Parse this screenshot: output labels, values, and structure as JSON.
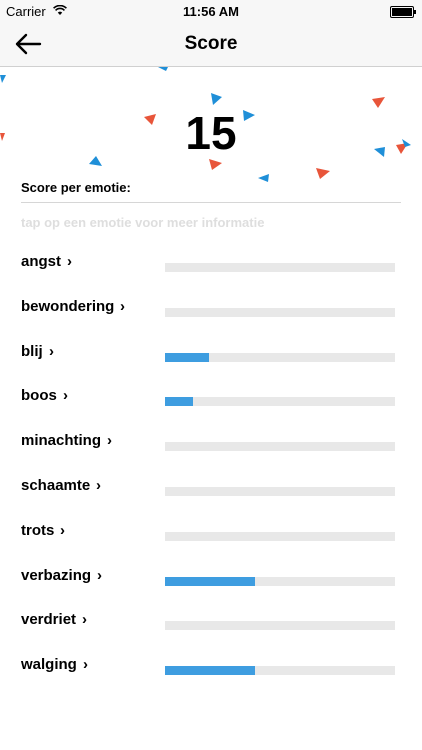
{
  "status": {
    "carrier": "Carrier",
    "time": "11:56 AM"
  },
  "nav": {
    "title": "Score"
  },
  "score": "15",
  "section_title": "Score per emotie:",
  "hint": "tap op een emotie voor meer informatie",
  "colors": {
    "bar_fill": "#3e9de0",
    "bar_track": "#e8e8e8",
    "confetti_red": "#e8553a",
    "confetti_blue": "#1f8fd8"
  },
  "emotions": [
    {
      "label": "angst",
      "level": 0
    },
    {
      "label": "bewondering",
      "level": 0
    },
    {
      "label": "blij",
      "level": 0.19
    },
    {
      "label": "boos",
      "level": 0.12
    },
    {
      "label": "minachting",
      "level": 0
    },
    {
      "label": "schaamte",
      "level": 0
    },
    {
      "label": "trots",
      "level": 0
    },
    {
      "label": "verbazing",
      "level": 0.39
    },
    {
      "label": "verdriet",
      "level": 0
    },
    {
      "label": "walging",
      "level": 0.39
    }
  ]
}
